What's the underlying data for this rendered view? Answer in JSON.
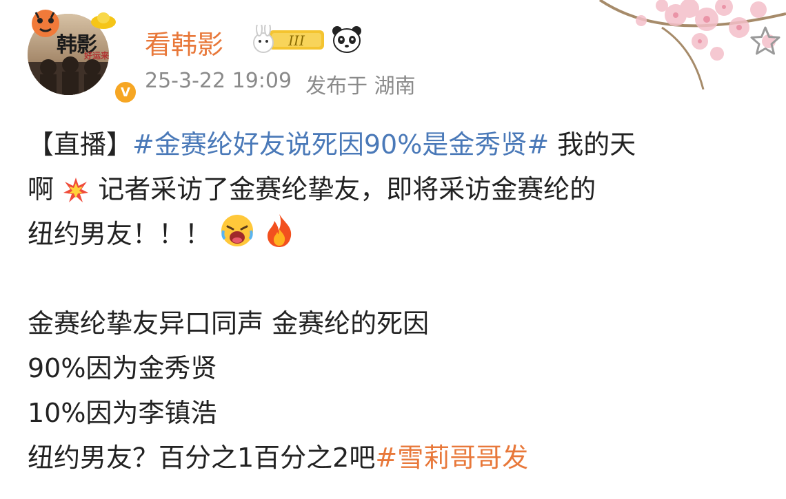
{
  "user": {
    "name": "看韩影",
    "avatar_text": "韩影",
    "avatar_sub": "好运来"
  },
  "meta": {
    "time": "25-3-22 19:09",
    "location": "发布于 湖南"
  },
  "post": {
    "l1_bracket": "【直播】",
    "l1_tag": "#金赛纶好友说死因90%是金秀贤#",
    "l1_text": " 我的天",
    "l2_a": "啊",
    "l2_b": " 记者采访了金赛纶挚友，即将采访金赛纶的",
    "l3": "纽约男友！！！ ",
    "l5": "金赛纶挚友异口同声 金赛纶的死因",
    "l6": "90%因为金秀贤",
    "l7": "10%因为李镇浩",
    "l8_text": "纽约男友？百分之1百分之2吧",
    "l8_tag": "#雪莉哥哥发"
  },
  "icons": [
    "verified-icon",
    "level-badge-icon",
    "panda-icon",
    "star-icon",
    "explosion-emoji",
    "crying-emoji",
    "fire-emoji"
  ],
  "colors": {
    "username": "#e8783a",
    "hashtag": "#4a79b8",
    "meta": "#8a8a8a",
    "verified": "#f6a623"
  }
}
